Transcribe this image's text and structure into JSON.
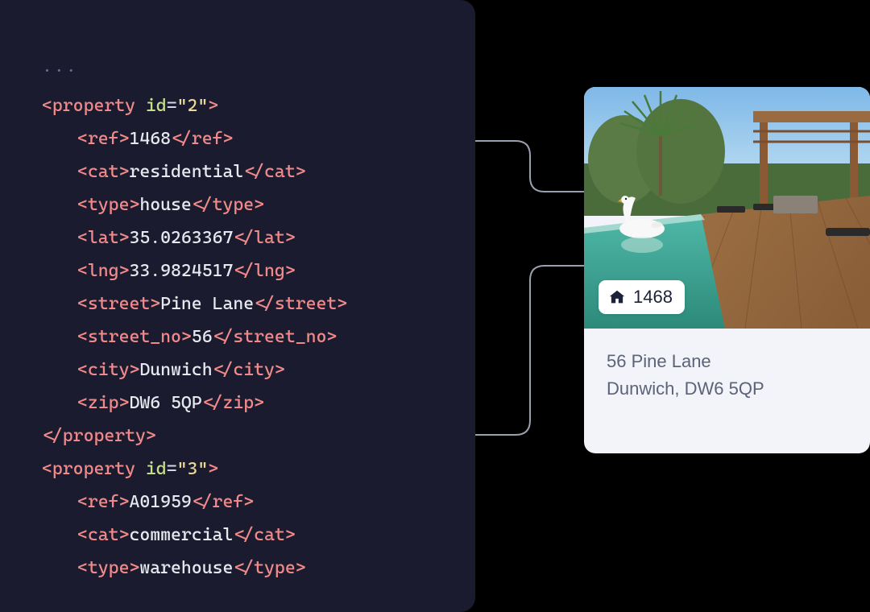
{
  "code": {
    "ellipsis": "...",
    "properties": [
      {
        "tag_open": "property",
        "id_attr": "id",
        "id_val": "2",
        "fields": {
          "ref_tag": "ref",
          "ref_val": "1468",
          "cat_tag": "cat",
          "cat_val": "residential",
          "type_tag": "type",
          "type_val": "house",
          "lat_tag": "lat",
          "lat_val": "35.0263367",
          "lng_tag": "lng",
          "lng_val": "33.9824517",
          "street_tag": "street",
          "street_val": "Pine Lane",
          "streetno_tag": "street_no",
          "streetno_val": "56",
          "city_tag": "city",
          "city_val": "Dunwich",
          "zip_tag": "zip",
          "zip_val": "DW6 5QP"
        },
        "tag_close": "property"
      },
      {
        "tag_open": "property",
        "id_attr": "id",
        "id_val": "3",
        "fields": {
          "ref_tag": "ref",
          "ref_val": "A01959",
          "cat_tag": "cat",
          "cat_val": "commercial",
          "type_tag": "type",
          "type_val": "warehouse"
        }
      }
    ]
  },
  "card": {
    "badge_ref": "1468",
    "address_line1": "56 Pine Lane",
    "address_line2": "Dunwich, DW6 5QP"
  }
}
